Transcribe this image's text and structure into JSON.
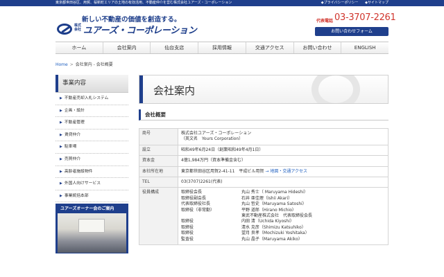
{
  "topbar": {
    "left_text": "東京都世田谷区、用賀、桜新町エリアの土地の有効活用、不動産仲介を営む株式会社ユアーズ・コーポレーション",
    "privacy": "◆プライバシーポリシー",
    "sitemap": "◆サイトマップ"
  },
  "brand": {
    "tagline": "新しい不動産の価値を創造する。",
    "kaisha": "株式会社",
    "company": "ユアーズ・コーポレーション"
  },
  "contact": {
    "phone_label": "代表電話",
    "phone": "03-3707-2261",
    "form_button": "お問い合わせフォーム"
  },
  "nav": {
    "items": [
      "ホーム",
      "会社案内",
      "仙台支店",
      "採用情報",
      "交通アクセス",
      "お問い合わせ",
      "ENGLISH"
    ]
  },
  "breadcrumb": {
    "home": "Home",
    "sep": ">",
    "current": "会社案内 - 会社概要"
  },
  "sidebar": {
    "heading": "事業内容",
    "arrow": "▶",
    "items": [
      "不動産売却入札システム",
      "企画・設計",
      "不動産管理",
      "賃貸仲介",
      "駐車場",
      "売買仲介",
      "高齢者施設物件",
      "外国人向けサービス",
      "事業統括本部"
    ],
    "owner_banner": "ユアーズオーナー会のご案内"
  },
  "main": {
    "title": "会社案内",
    "section": "会社概要",
    "rows": {
      "name_label": "商号",
      "name_value": "株式会社ユアーズ・コーポレーション",
      "name_en": "（英文名　Yours Corporation）",
      "est_label": "設立",
      "est_value": "昭和49年6月24日（創業昭和49年4月1日）",
      "capital_label": "資本金",
      "capital_value": "4億1,984万円（資本準備金含む）",
      "hq_label": "本社所在地",
      "hq_value": "東京都世田谷区用賀2-41-11　平成ビル用賀",
      "hq_link": "→ 地図・交通アクセス",
      "tel_label": "TEL",
      "tel_value": "03(3707)2261(代表)",
      "officers_label": "役員構成"
    },
    "officers": [
      {
        "role": "取締役会長",
        "name": "丸山 秀士（ Maruyama Hideshi）"
      },
      {
        "role": "取締役副会長",
        "name": "石井 亜佳理（Ishii Akari）"
      },
      {
        "role": "代表取締役社長",
        "name": "丸山 哲史（Maruyama Satoshi）"
      },
      {
        "role": "取締役（非常勤）",
        "name": "平野 道郎（Hirano Michio）"
      },
      {
        "role": "",
        "name": "東武不動産株式会社　代表取締役会長"
      },
      {
        "role": "取締役",
        "name": "内田 清（Uchida Kiyoshi）"
      },
      {
        "role": "取締役",
        "name": "清水 克彦（Shimizu Katsuhiko）"
      },
      {
        "role": "取締役",
        "name": "望月 良孝（Mochizuki Yoshitaka）"
      },
      {
        "role": "監査役",
        "name": "丸山 晶子（Maruyama Akiko）"
      }
    ]
  }
}
